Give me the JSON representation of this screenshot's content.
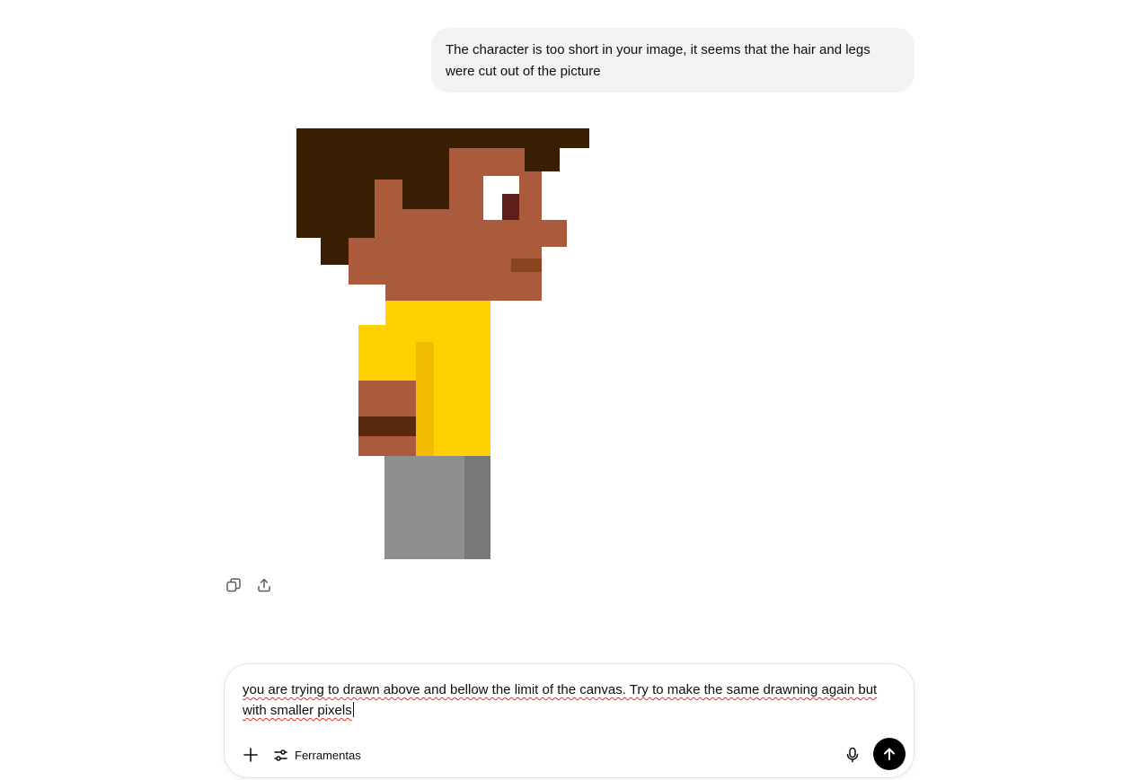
{
  "conversation": {
    "user_message": "The character is too short in your image, it seems that the hair and legs were cut out of the picture"
  },
  "image": {
    "colors": {
      "hair": "#3a1e03",
      "skin": "#a95b3c",
      "eye_white": "#ffffff",
      "pupil": "#5e1e1c",
      "mouth": "#8b4420",
      "shirt": "#ffd100",
      "shirt_shade": "#f0bd00",
      "bracelet": "#5a2a0e",
      "pants": "#8f8f8f",
      "pants_shade": "#787878"
    }
  },
  "message_actions": {
    "copy_icon": "copy-icon",
    "share_icon": "share-icon"
  },
  "composer": {
    "input_text": "you are trying to drawn above and bellow the limit of the canvas. Try to make the same drawning again but with smaller pixels",
    "tools_label": "Ferramentas",
    "plus_icon": "plus-icon",
    "tools_icon": "sliders-icon",
    "mic_icon": "microphone-icon",
    "send_icon": "arrow-up-icon"
  }
}
